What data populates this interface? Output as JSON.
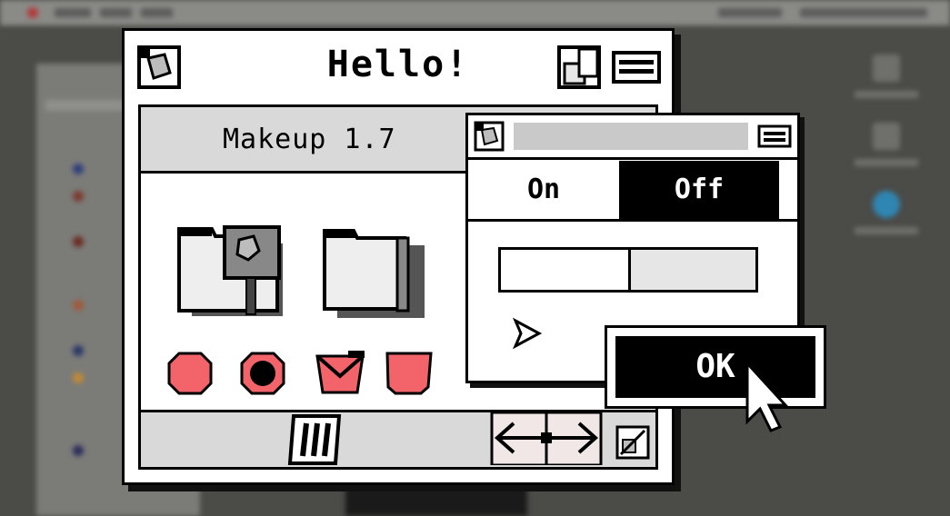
{
  "main_window": {
    "title": "Hello!",
    "panel_title": "Makeup 1.7"
  },
  "toggle_window": {
    "on_label": "On",
    "off_label": "Off",
    "slider_value": 0.5
  },
  "ok_button": {
    "label": "OK"
  },
  "colors": {
    "accent_red": "#f2636a",
    "panel_gray": "#d9d9d9",
    "backdrop": "#4b4b48"
  }
}
